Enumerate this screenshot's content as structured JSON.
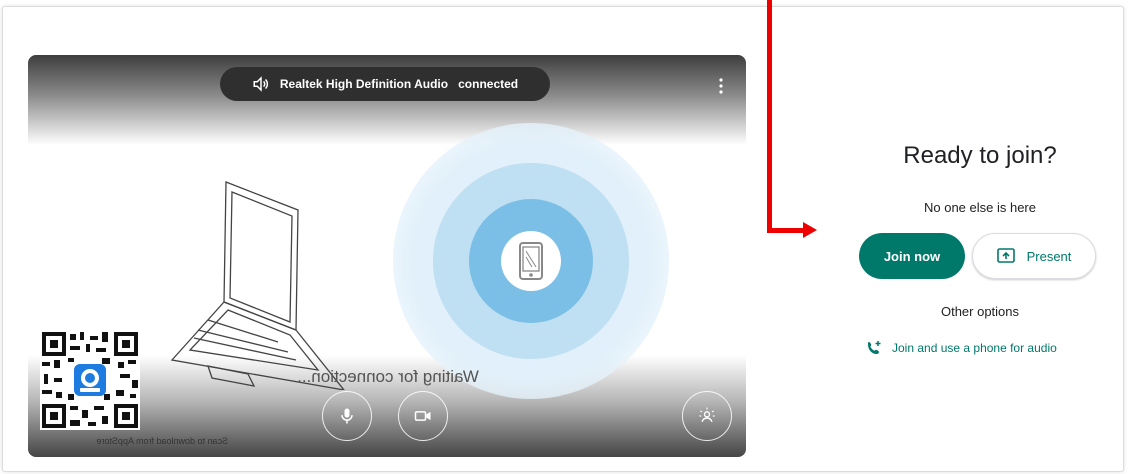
{
  "preview": {
    "audio_device": "Realtek High Definition Audio",
    "audio_status": "connected",
    "waiting_text": "Waiting for connection...",
    "qr_caption": "Scan to download from AppStore"
  },
  "join_panel": {
    "title": "Ready to join?",
    "subtitle": "No one else is here",
    "join_now_label": "Join now",
    "present_label": "Present",
    "other_options_label": "Other options",
    "phone_audio_label": "Join and use a phone for audio"
  },
  "colors": {
    "accent": "#00796b",
    "annotation": "#ee0000"
  },
  "icons": [
    "speaker-icon",
    "more-vert-icon",
    "phone-device-icon",
    "microphone-icon",
    "camera-icon",
    "effects-icon",
    "present-screen-icon",
    "add-phone-icon"
  ]
}
